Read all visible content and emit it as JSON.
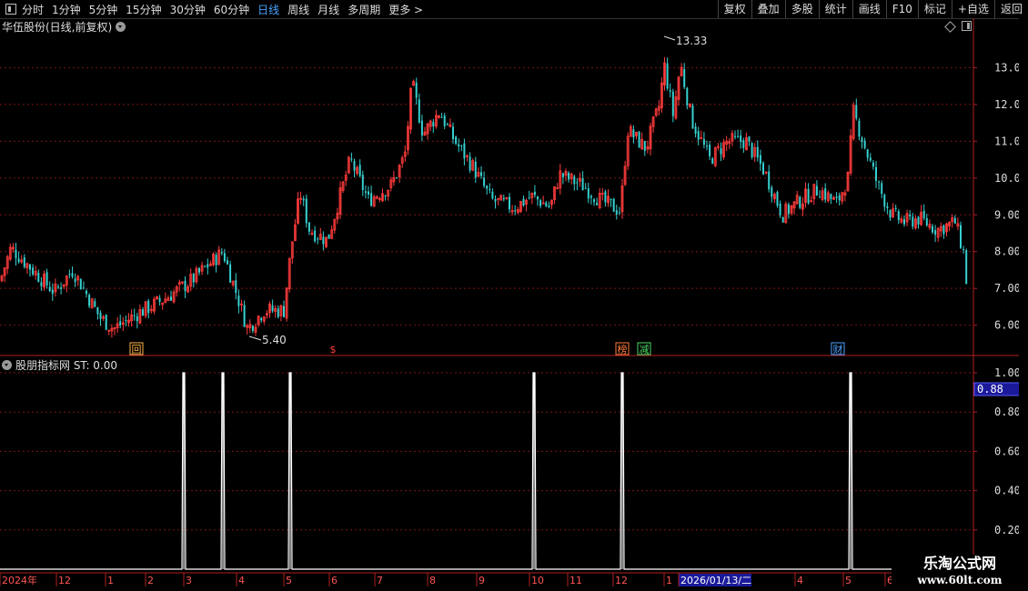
{
  "toolbar": {
    "periods": [
      "分时",
      "1分钟",
      "5分钟",
      "15分钟",
      "30分钟",
      "60分钟",
      "日线",
      "周线",
      "月线",
      "多周期",
      "更多 >"
    ],
    "active_period": "日线",
    "tools": [
      "复权",
      "叠加",
      "多股",
      "统计",
      "画线",
      "F10",
      "标记",
      "+自选",
      "返回"
    ]
  },
  "chart_header": {
    "title": "华伍股份(日线,前复权)"
  },
  "indicator_header": {
    "title": "股朋指标网 ST: 0.00"
  },
  "colors": {
    "up": "#ff3b3b",
    "down": "#36d0d0",
    "grid": "#7a1515",
    "axis_text": "#dddddd",
    "signal_line": "#ffffff",
    "cursor_box": "#1a1a9a"
  },
  "chart_data": [
    {
      "type": "candlestick",
      "title": "华伍股份(日线,前复权)",
      "y_ticks": [
        6.0,
        7.0,
        8.0,
        9.0,
        10.0,
        11.0,
        12.0,
        13.0
      ],
      "ylim": [
        5.2,
        13.9
      ],
      "annotations": [
        {
          "text": "13.33",
          "kind": "high"
        },
        {
          "text": "5.40",
          "kind": "low"
        }
      ],
      "event_markers": [
        {
          "text": "回",
          "color": "#ffb347"
        },
        {
          "text": "$",
          "color": "#ff3b3b"
        },
        {
          "text": "榜",
          "color": "#ff7a3b"
        },
        {
          "text": "减",
          "color": "#4cd964"
        },
        {
          "text": "财",
          "color": "#4aa3ff"
        }
      ],
      "trend": [
        [
          0,
          7.2
        ],
        [
          12,
          8.1
        ],
        [
          40,
          7.4
        ],
        [
          60,
          6.9
        ],
        [
          80,
          7.5
        ],
        [
          110,
          6.2
        ],
        [
          125,
          5.9
        ],
        [
          150,
          6.3
        ],
        [
          180,
          6.7
        ],
        [
          210,
          7.2
        ],
        [
          245,
          8.0
        ],
        [
          262,
          6.7
        ],
        [
          272,
          5.9
        ],
        [
          290,
          6.4
        ],
        [
          312,
          6.4
        ],
        [
          320,
          8.1
        ],
        [
          330,
          9.6
        ],
        [
          340,
          8.6
        ],
        [
          360,
          8.3
        ],
        [
          385,
          10.5
        ],
        [
          405,
          9.4
        ],
        [
          430,
          9.8
        ],
        [
          445,
          10.6
        ],
        [
          453,
          12.6
        ],
        [
          465,
          11.2
        ],
        [
          483,
          11.8
        ],
        [
          500,
          11.0
        ],
        [
          520,
          10.3
        ],
        [
          540,
          9.4
        ],
        [
          565,
          9.2
        ],
        [
          585,
          9.5
        ],
        [
          605,
          9.2
        ],
        [
          615,
          10.1
        ],
        [
          640,
          9.8
        ],
        [
          660,
          9.4
        ],
        [
          682,
          9.1
        ],
        [
          690,
          11.3
        ],
        [
          710,
          10.8
        ],
        [
          725,
          12.0
        ],
        [
          730,
          13.1
        ],
        [
          740,
          11.7
        ],
        [
          748,
          13.1
        ],
        [
          760,
          11.6
        ],
        [
          780,
          10.5
        ],
        [
          800,
          11.0
        ],
        [
          820,
          11.0
        ],
        [
          840,
          10.2
        ],
        [
          860,
          9.0
        ],
        [
          880,
          9.4
        ],
        [
          900,
          9.7
        ],
        [
          920,
          9.3
        ],
        [
          932,
          10.0
        ],
        [
          938,
          11.8
        ],
        [
          950,
          10.9
        ],
        [
          965,
          9.8
        ],
        [
          980,
          9.0
        ],
        [
          995,
          8.8
        ],
        [
          1010,
          8.9
        ],
        [
          1030,
          8.6
        ],
        [
          1050,
          8.8
        ],
        [
          1060,
          7.9
        ],
        [
          1063,
          6.95
        ]
      ]
    },
    {
      "type": "line",
      "series": [
        {
          "name": "ST",
          "values": [
            0.0
          ]
        }
      ],
      "y_ticks": [
        0.2,
        0.4,
        0.6,
        0.8,
        1.0
      ],
      "ylim": [
        0,
        1.0
      ],
      "cursor_value": "0.88",
      "spikes": [
        {
          "x_index": 202,
          "value": 1.0
        },
        {
          "x_index": 245,
          "value": 1.0
        },
        {
          "x_index": 319,
          "value": 1.0
        },
        {
          "x_index": 587,
          "value": 1.0
        },
        {
          "x_index": 684,
          "value": 1.0
        },
        {
          "x_index": 935,
          "value": 1.0
        }
      ]
    }
  ],
  "date_axis": {
    "labels": [
      "2024年",
      "12",
      "1",
      "2",
      "3",
      "4",
      "5",
      "6",
      "7",
      "8",
      "9",
      "10",
      "11",
      "12",
      "1",
      "2026/01/13/二",
      "4",
      "5",
      "6"
    ]
  },
  "watermark": {
    "line1": "乐淘公式网",
    "line2": "www.60lt.com"
  }
}
